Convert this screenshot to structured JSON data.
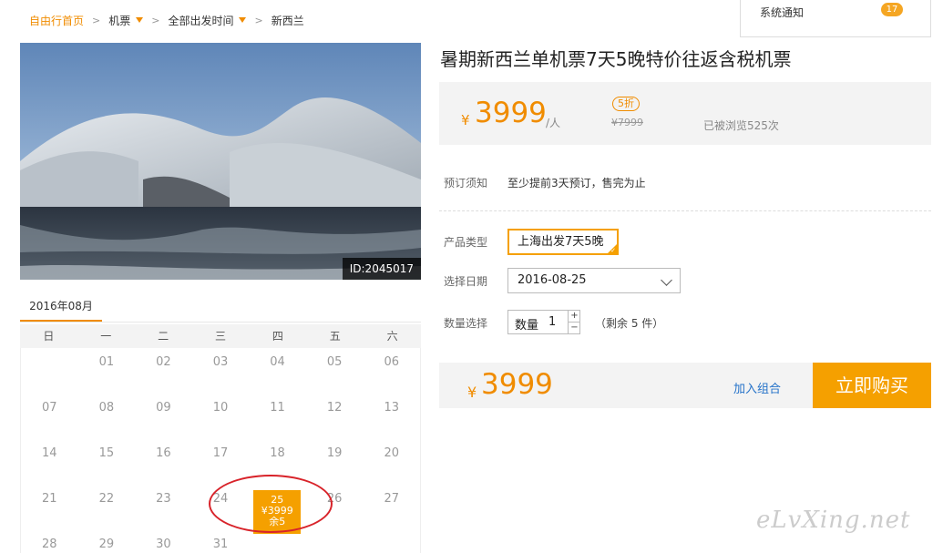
{
  "breadcrumb": {
    "home": "自由行首页",
    "category": "机票",
    "departure": "全部出发时间",
    "destination": "新西兰"
  },
  "notification": {
    "label": "系统通知",
    "count": "17"
  },
  "product": {
    "image_id": "ID:2045017",
    "title": "暑期新西兰单机票7天5晚特价往返含税机票",
    "currency": "¥",
    "price": "3999",
    "price_unit": "/人",
    "discount": "5折",
    "original_price": "¥7999",
    "views": "已被浏览525次"
  },
  "booking": {
    "notice_label": "预订须知",
    "notice_text": "至少提前3天预订，售完为止",
    "type_label": "产品类型",
    "type_value": "上海出发7天5晚",
    "date_label": "选择日期",
    "date_value": "2016-08-25",
    "qty_label": "数量选择",
    "qty_inner_label": "数量",
    "qty_value": "1",
    "qty_plus": "+",
    "qty_minus": "−",
    "stock_text": "（剩余 5 件）"
  },
  "buybar": {
    "currency": "¥",
    "price": "3999",
    "add_label": "加入组合",
    "buy_label": "立即购买"
  },
  "calendar": {
    "month": "2016年08月",
    "weekdays": [
      "日",
      "一",
      "二",
      "三",
      "四",
      "五",
      "六"
    ],
    "days": [
      "",
      "01",
      "02",
      "03",
      "04",
      "05",
      "06",
      "07",
      "08",
      "09",
      "10",
      "11",
      "12",
      "13",
      "14",
      "15",
      "16",
      "17",
      "18",
      "19",
      "20",
      "21",
      "22",
      "23",
      "24",
      "25",
      "26",
      "27",
      "28",
      "29",
      "30",
      "31",
      "",
      "",
      ""
    ],
    "selected_day": "25",
    "selected_price": "¥3999",
    "selected_stock": "余5"
  },
  "watermark": "eLvXing.net",
  "colors": {
    "accent": "#f08c00",
    "button": "#f5a000",
    "link": "#2673c9",
    "highlight_circle": "#d8232a"
  }
}
